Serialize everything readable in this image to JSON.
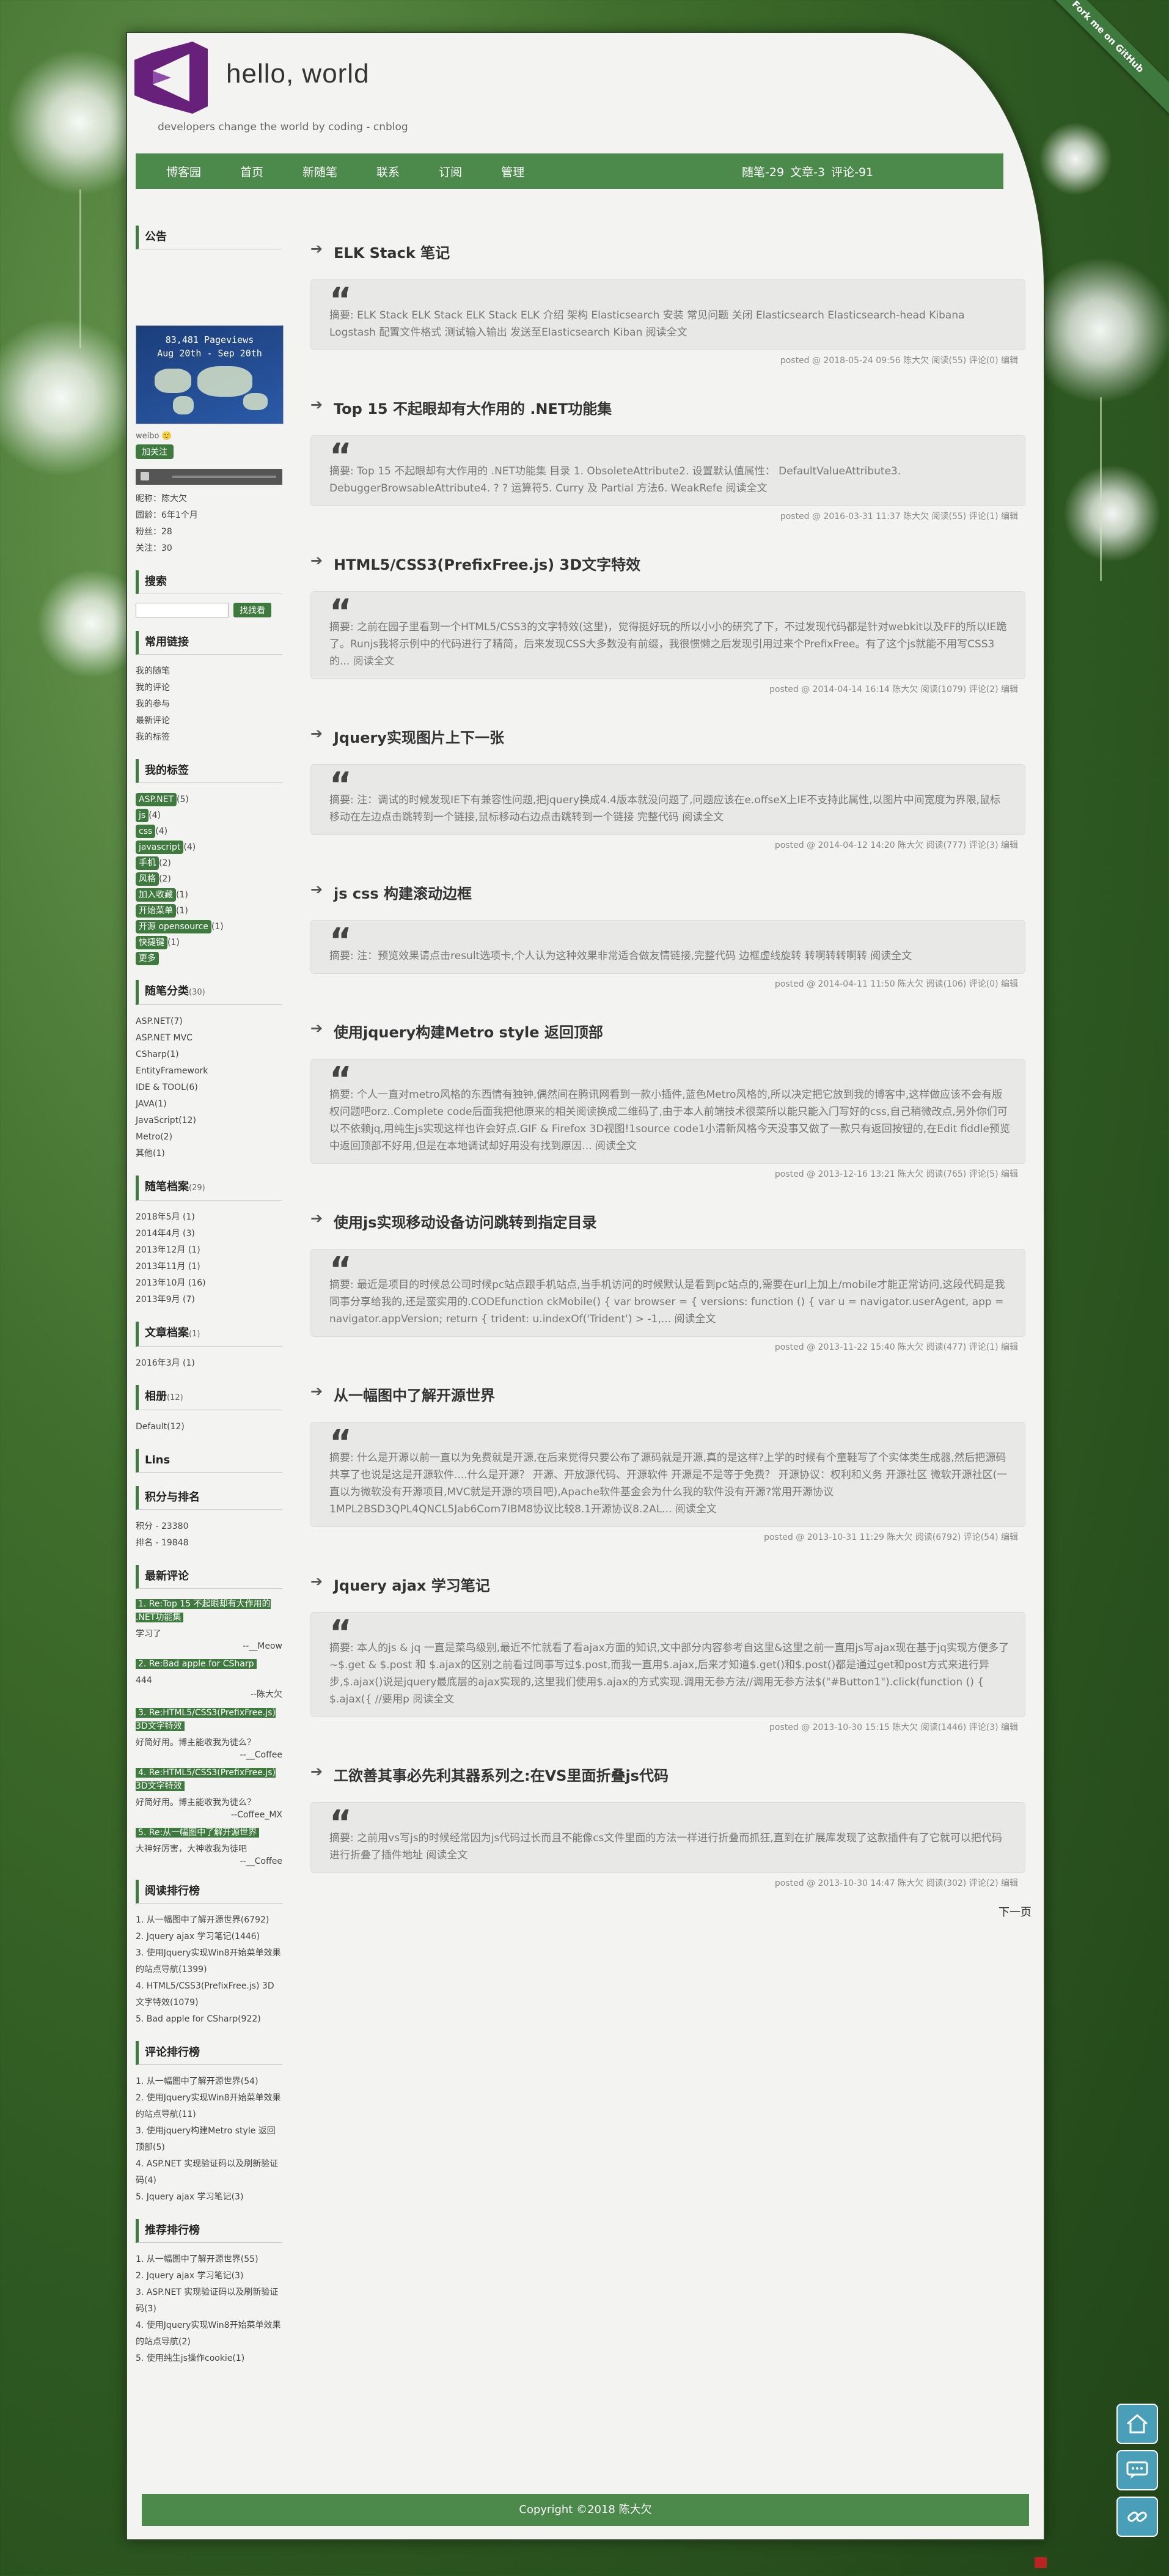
{
  "header": {
    "title": "hello, world",
    "subtitle": "developers change the world by coding - cnblog",
    "ribbon": "Fork me on GitHub"
  },
  "nav": {
    "items": [
      "博客园",
      "首页",
      "新随笔",
      "联系",
      "订阅",
      "管理"
    ],
    "stats": [
      "随笔-29",
      "文章-3",
      "评论-91"
    ]
  },
  "sidebar": {
    "announce_title": "公告",
    "map_line1": "83,481 Pageviews",
    "map_line2": "Aug 20th - Sep 20th",
    "weibo_alt": "weibo",
    "follow_label": "加关注",
    "profile": [
      "昵称：陈大欠",
      "园龄：6年1个月",
      "粉丝：28",
      "关注：30"
    ],
    "search_title": "搜索",
    "search_button": "找找看",
    "links_title": "常用链接",
    "links": [
      "我的随笔",
      "我的评论",
      "我的参与",
      "最新评论",
      "我的标签"
    ],
    "tags_title": "我的标签",
    "tags": [
      {
        "name": "ASP.NET",
        "count": "(5)"
      },
      {
        "name": "js",
        "count": "(4)"
      },
      {
        "name": "css",
        "count": "(4)"
      },
      {
        "name": "javascript",
        "count": "(4)"
      },
      {
        "name": "手机",
        "count": "(2)"
      },
      {
        "name": "风格",
        "count": "(2)"
      },
      {
        "name": "加入收藏",
        "count": "(1)"
      },
      {
        "name": "开始菜单",
        "count": "(1)"
      },
      {
        "name": "开源 opensource",
        "count": "(1)"
      },
      {
        "name": "快捷键",
        "count": "(1)"
      },
      {
        "name": "更多",
        "count": ""
      }
    ],
    "categories_title": "随笔分类",
    "categories_count": "(30)",
    "categories": [
      "ASP.NET(7)",
      "ASP.NET MVC",
      "CSharp(1)",
      "EntityFramework",
      "IDE & TOOL(6)",
      "JAVA(1)",
      "JavaScript(12)",
      "Metro(2)",
      "其他(1)"
    ],
    "archive_title": "随笔档案",
    "archive_count": "(29)",
    "archive": [
      "2018年5月 (1)",
      "2014年4月 (3)",
      "2013年12月 (1)",
      "2013年11月 (1)",
      "2013年10月 (16)",
      "2013年9月 (7)"
    ],
    "article_archive_title": "文章档案",
    "article_archive_count": "(1)",
    "article_archive": [
      "2016年3月 (1)"
    ],
    "album_title": "相册",
    "album_count": "(12)",
    "album": [
      "Default(12)"
    ],
    "lins_title": "Lins",
    "score_title": "积分与排名",
    "score": [
      "积分 - 23380",
      "排名 - 19848"
    ],
    "recent_comments_title": "最新评论",
    "recent_comments": [
      {
        "title": "1. Re:Top 15 不起眼却有大作用的 .NET功能集",
        "body": "学习了",
        "author": "--__Meow"
      },
      {
        "title": "2. Re:Bad apple for CSharp",
        "body": "444",
        "author": "--陈大欠"
      },
      {
        "title": "3. Re:HTML5/CSS3(PrefixFree.js) 3D文字特效",
        "body": "好简好用。博主能收我为徒么？",
        "author": "--__Coffee"
      },
      {
        "title": "4. Re:HTML5/CSS3(PrefixFree.js) 3D文字特效",
        "body": "好简好用。博主能收我为徒么？",
        "author": "--Coffee_MX"
      },
      {
        "title": "5. Re:从一幅图中了解开源世界",
        "body": "大神好厉害，大神收我为徒吧",
        "author": "--__Coffee"
      }
    ],
    "read_rank_title": "阅读排行榜",
    "read_rank": [
      "1. 从一幅图中了解开源世界(6792)",
      "2. Jquery ajax 学习笔记(1446)",
      "3. 使用Jquery实现Win8开始菜单效果的站点导航(1399)",
      "4. HTML5/CSS3(PrefixFree.js) 3D文字特效(1079)",
      "5. Bad apple for CSharp(922)"
    ],
    "comment_rank_title": "评论排行榜",
    "comment_rank": [
      "1. 从一幅图中了解开源世界(54)",
      "2. 使用Jquery实现Win8开始菜单效果的站点导航(11)",
      "3. 使用jquery构建Metro style 返回顶部(5)",
      "4. ASP.NET 实现验证码以及刷新验证码(4)",
      "5. Jquery ajax 学习笔记(3)"
    ],
    "recommend_rank_title": "推荐排行榜",
    "recommend_rank": [
      "1. 从一幅图中了解开源世界(55)",
      "2. Jquery ajax 学习笔记(3)",
      "3. ASP.NET 实现验证码以及刷新验证码(3)",
      "4. 使用Jquery实现Win8开始菜单效果的站点导航(2)",
      "5. 使用纯生js操作cookie(1)"
    ]
  },
  "posts": [
    {
      "title": "ELK Stack 笔记",
      "summary": "摘要: ELK Stack ELK Stack ELK Stack ELK 介绍 架构 Elasticsearch 安装 常见问题 关闭 Elasticsearch Elasticsearch-head Kibana Logstash 配置文件格式 测试输入输出 发送至Elasticsearch Kiban 阅读全文",
      "meta": "posted @ 2018-05-24 09:56 陈大欠 阅读(55) 评论(0) 编辑"
    },
    {
      "title": "Top 15 不起眼却有大作用的 .NET功能集",
      "summary": "摘要: Top 15 不起眼却有大作用的 .NET功能集 目录 1. ObsoleteAttribute2. 设置默认值属性： DefaultValueAttribute3. DebuggerBrowsableAttribute4. ? ? 运算符5. Curry 及 Partial 方法6. WeakRefe 阅读全文",
      "meta": "posted @ 2016-03-31 11:37 陈大欠 阅读(55) 评论(1) 编辑"
    },
    {
      "title": "HTML5/CSS3(PrefixFree.js) 3D文字特效",
      "summary": "摘要: 之前在园子里看到一个HTML5/CSS3的文字特效(这里)，觉得挺好玩的所以小小的研究了下，不过发现代码都是针对webkit以及FF的所以IE跪了。Runjs我将示例中的代码进行了精简，后来发现CSS大多数没有前缀，我很惯懒之后发现引用过来个PrefixFree。有了这个js就能不用写CSS3的... 阅读全文",
      "meta": "posted @ 2014-04-14 16:14 陈大欠 阅读(1079) 评论(2) 编辑"
    },
    {
      "title": "Jquery实现图片上下一张",
      "summary": "摘要: 注：调试的时候发现IE下有兼容性问题,把jquery换成4.4版本就没问题了,问题应该在e.offseX上IE不支持此属性,以图片中间宽度为界限,鼠标移动在左边点击跳转到一个链接,鼠标移动右边点击跳转到一个链接 完整代码 阅读全文",
      "meta": "posted @ 2014-04-12 14:20 陈大欠 阅读(777) 评论(3) 编辑"
    },
    {
      "title": "js css 构建滚动边框",
      "summary": "摘要: 注：预览效果请点击result选项卡,个人认为这种效果非常适合做友情链接,完整代码 边框虚线旋转 转啊转转啊转 阅读全文",
      "meta": "posted @ 2014-04-11 11:50 陈大欠 阅读(106) 评论(0) 编辑"
    },
    {
      "title": "使用jquery构建Metro style 返回顶部",
      "summary": "摘要: 个人一直对metro风格的东西情有独钟,偶然间在腾讯网看到一款小插件,蓝色Metro风格的,所以决定把它放到我的博客中,这样做应该不会有版权问题吧orz..Complete code后面我把他原来的相关阅读换成二维码了,由于本人前端技术很菜所以能只能入门写好的css,自己稍微改点,另外你们可以不依赖jq,用纯生js实现这样也许会好点.GIF & Firefox 3D视图!1source code1小清新风格今天没事又做了一款只有返回按钮的,在Edit fiddle预览中返回顶部不好用,但是在本地调试却好用没有找到原因... 阅读全文",
      "meta": "posted @ 2013-12-16 13:21 陈大欠 阅读(765) 评论(5) 编辑"
    },
    {
      "title": "使用js实现移动设备访问跳转到指定目录",
      "summary": "摘要: 最近是项目的时候总公司时候pc站点跟手机站点,当手机访问的时候默认是看到pc站点的,需要在url上加上/mobile才能正常访问,这段代码是我同事分享给我的,还是蛮实用的.CODEfunction ckMobile() { var browser = { versions: function () { var u = navigator.userAgent, app = navigator.appVersion; return { trident: u.indexOf('Trident') > -1,... 阅读全文",
      "meta": "posted @ 2013-11-22 15:40 陈大欠 阅读(477) 评论(1) 编辑"
    },
    {
      "title": "从一幅图中了解开源世界",
      "summary": "摘要: 什么是开源以前一直以为免费就是开源,在后来觉得只要公布了源码就是开源,真的是这样?上学的时候有个童鞋写了个实体类生成器,然后把源码共享了也说是这是开源软件....什么是开源？ 开源、开放源代码、开源软件 开源是不是等于免费？ 开源协议：权利和义务 开源社区 微软开源社区(一直以为微软没有开源项目,MVC就是开源的项目吧),Apache软件基金会为什么我的软件没有开源?常用开源协议1MPL2BSD3QPL4QNCL5Jab6Com7IBM8协议比较8.1开源协议8.2AL... 阅读全文",
      "meta": "posted @ 2013-10-31 11:29 陈大欠 阅读(6792) 评论(54) 编辑"
    },
    {
      "title": "Jquery ajax 学习笔记",
      "summary": "摘要: 本人的js & jq 一直是菜鸟级别,最近不忙就看了看ajax方面的知识,文中部分内容参考自这里&这里之前一直用js写ajax现在基于jq实现方便多了~$.get & $.post 和 $.ajax的区别之前看过同事写过$.post,而我一直用$.ajax,后来才知道$.get()和$.post()都是通过get和post方式来进行异步,$.ajax()说是jquery最底层的ajax实现的,这里我们使用$.ajax的方式实现.调用无参方法//调用无参方法$(\"#Button1\").click(function () { $.ajax({ //要用p 阅读全文",
      "meta": "posted @ 2013-10-30 15:15 陈大欠 阅读(1446) 评论(3) 编辑"
    },
    {
      "title": "工欲善其事必先利其器系列之:在VS里面折叠js代码",
      "summary": "摘要: 之前用vs写js的时候经常因为js代码过长而且不能像cs文件里面的方法一样进行折叠而抓狂,直到在扩展库发现了这款插件有了它就可以把代码进行折叠了插件地址 阅读全文",
      "meta": "posted @ 2013-10-30 14:47 陈大欠 阅读(302) 评论(2) 编辑"
    }
  ],
  "pagination": {
    "next": "下一页"
  },
  "footer": {
    "copyright": "Copyright ©2018 陈大欠"
  },
  "colors": {
    "accent": "#4b8a4b",
    "tag": "#3e7a3e",
    "float_button": "#4a9fb8",
    "logo": "#68217a"
  },
  "icons": {
    "scroll_top": "home-icon",
    "comment": "comment-icon",
    "link": "link-icon"
  }
}
